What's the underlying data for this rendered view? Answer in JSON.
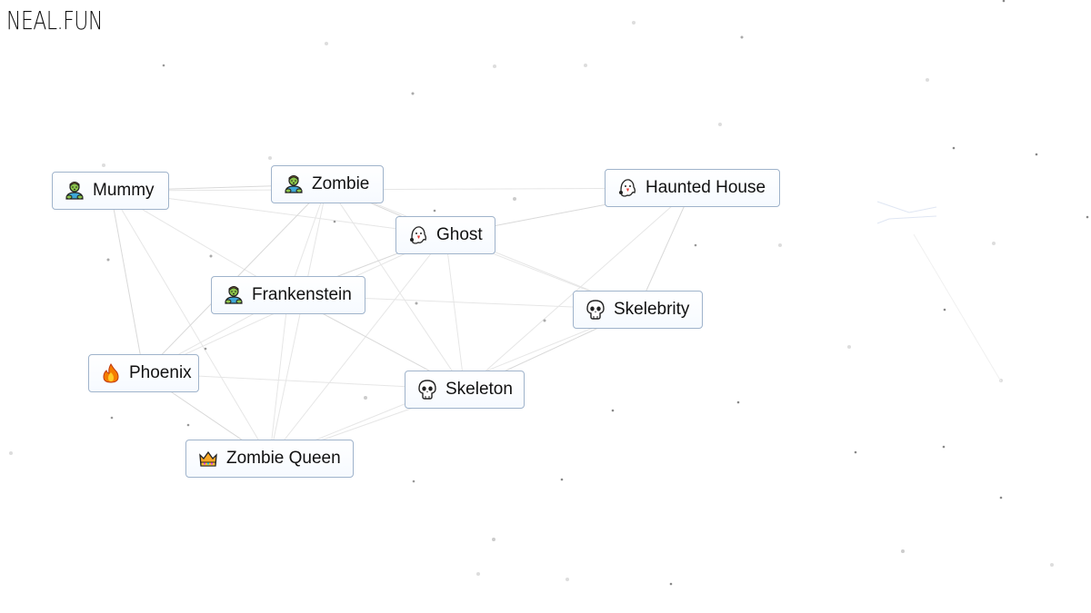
{
  "site": {
    "logo_text": "NEAL.FUN"
  },
  "nodes": [
    {
      "id": "mummy",
      "label": "Mummy",
      "icon": "zombie-icon"
    },
    {
      "id": "zombie",
      "label": "Zombie",
      "icon": "zombie-icon"
    },
    {
      "id": "haunted-house",
      "label": "Haunted House",
      "icon": "ghost-icon"
    },
    {
      "id": "ghost",
      "label": "Ghost",
      "icon": "ghost-icon"
    },
    {
      "id": "frankenstein",
      "label": "Frankenstein",
      "icon": "zombie-icon"
    },
    {
      "id": "skelebrity",
      "label": "Skelebrity",
      "icon": "skull-icon"
    },
    {
      "id": "phoenix",
      "label": "Phoenix",
      "icon": "fire-icon"
    },
    {
      "id": "skeleton",
      "label": "Skeleton",
      "icon": "skull-icon"
    },
    {
      "id": "zombie-queen",
      "label": "Zombie Queen",
      "icon": "crown-icon"
    }
  ],
  "edges": [
    [
      "mummy",
      "zombie"
    ],
    [
      "mummy",
      "ghost"
    ],
    [
      "mummy",
      "frankenstein"
    ],
    [
      "mummy",
      "phoenix"
    ],
    [
      "mummy",
      "zombie-queen"
    ],
    [
      "mummy",
      "haunted-house"
    ],
    [
      "zombie",
      "ghost"
    ],
    [
      "zombie",
      "frankenstein"
    ],
    [
      "zombie",
      "skeleton"
    ],
    [
      "zombie",
      "phoenix"
    ],
    [
      "zombie",
      "zombie-queen"
    ],
    [
      "zombie",
      "skelebrity"
    ],
    [
      "ghost",
      "haunted-house"
    ],
    [
      "ghost",
      "skeleton"
    ],
    [
      "ghost",
      "skelebrity"
    ],
    [
      "ghost",
      "frankenstein"
    ],
    [
      "ghost",
      "zombie-queen"
    ],
    [
      "ghost",
      "phoenix"
    ],
    [
      "haunted-house",
      "skelebrity"
    ],
    [
      "haunted-house",
      "skeleton"
    ],
    [
      "frankenstein",
      "skelebrity"
    ],
    [
      "frankenstein",
      "skeleton"
    ],
    [
      "frankenstein",
      "phoenix"
    ],
    [
      "frankenstein",
      "zombie-queen"
    ],
    [
      "skelebrity",
      "skeleton"
    ],
    [
      "skelebrity",
      "zombie-queen"
    ],
    [
      "phoenix",
      "skeleton"
    ],
    [
      "phoenix",
      "zombie-queen"
    ],
    [
      "skeleton",
      "zombie-queen"
    ]
  ]
}
